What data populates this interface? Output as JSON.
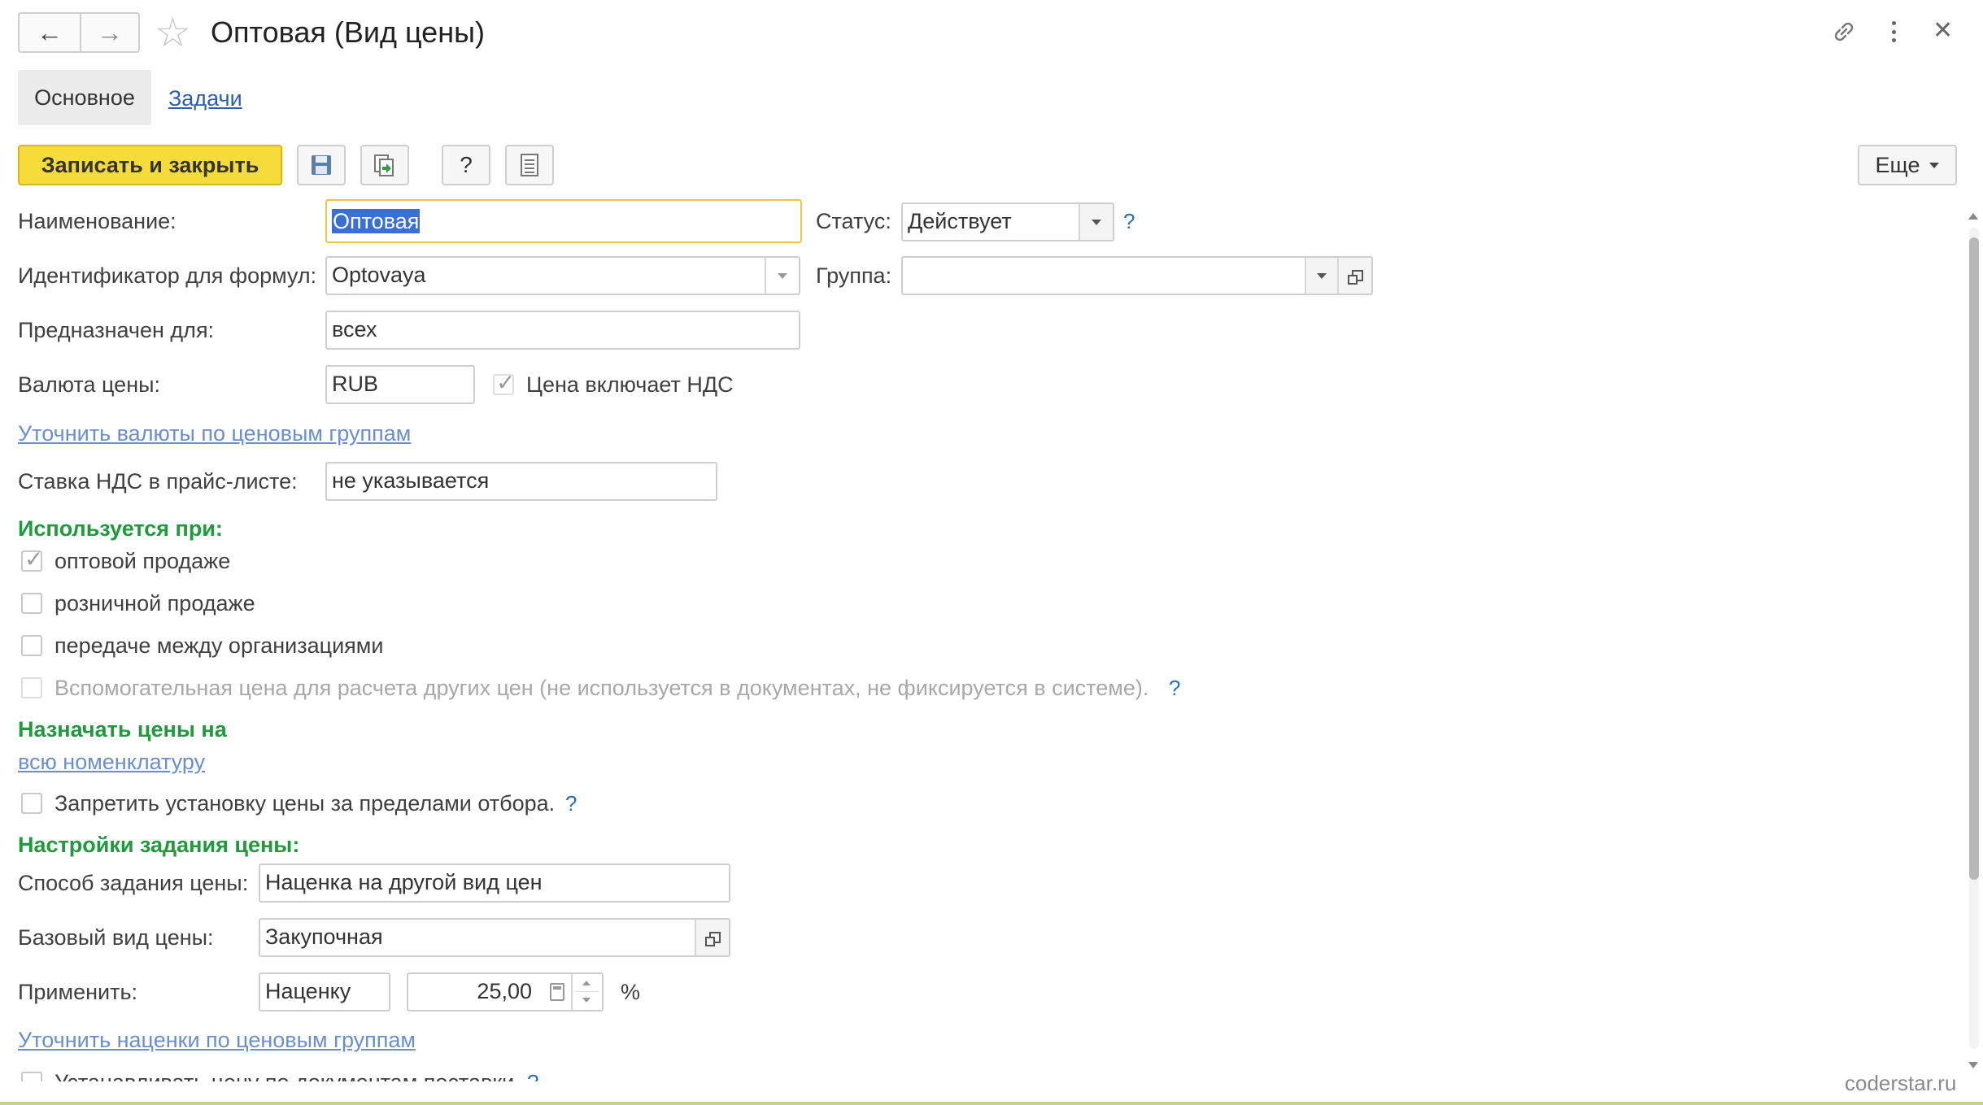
{
  "window": {
    "title": "Оптовая (Вид цены)"
  },
  "tabs": [
    {
      "label": "Основное"
    },
    {
      "label": "Задачи"
    }
  ],
  "toolbar": {
    "save_close_label": "Записать и закрыть",
    "help_label": "?",
    "more_label": "Еще"
  },
  "form": {
    "name_label": "Наименование:",
    "name_value": "Оптовая",
    "status_label": "Статус:",
    "status_value": "Действует",
    "status_help": "?",
    "id_label": "Идентификатор для формул:",
    "id_value": "Optovaya",
    "group_label": "Группа:",
    "group_value": "",
    "for_label": "Предназначен для:",
    "for_value": "всех",
    "currency_label": "Валюта цены:",
    "currency_value": "RUB",
    "vat_included_label": "Цена включает НДС",
    "vat_included_checked": true,
    "refine_currency_link": "Уточнить валюты по ценовым группам",
    "vat_rate_label": "Ставка НДС в прайс-листе:",
    "vat_rate_value": "не указывается"
  },
  "used_for": {
    "heading": "Используется при:",
    "items": [
      {
        "label": "оптовой продаже",
        "checked": true,
        "disabled": false
      },
      {
        "label": "розничной продаже",
        "checked": false,
        "disabled": false
      },
      {
        "label": "передаче между организациями",
        "checked": false,
        "disabled": false
      },
      {
        "label": "Вспомогательная цена для расчета других цен (не используется в документах, не фиксируется в системе).",
        "checked": false,
        "disabled": true
      }
    ],
    "aux_help": "?"
  },
  "assign": {
    "heading": "Назначать цены на",
    "scope_link": "всю номенклатуру",
    "forbid_label": "Запретить установку цены за пределами отбора.",
    "forbid_help": "?"
  },
  "price_settings": {
    "heading": "Настройки задания цены:",
    "method_label": "Способ задания цены:",
    "method_value": "Наценка на другой вид цен",
    "base_label": "Базовый вид цены:",
    "base_value": "Закупочная",
    "apply_label": "Применить:",
    "apply_value": "Наценку",
    "markup_value": "25,00",
    "percent_sign": "%",
    "refine_markup_link": "Уточнить наценки по ценовым группам",
    "from_delivery_label": "Устанавливать цену по документам поставки",
    "from_delivery_help": "?"
  },
  "watermark": "coderstar.ru"
}
